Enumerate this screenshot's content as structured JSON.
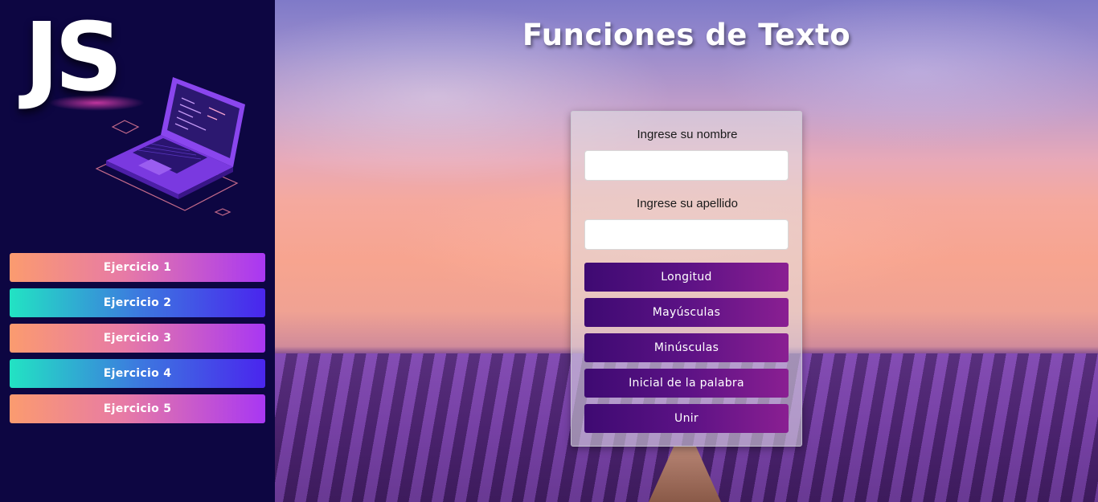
{
  "sidebar": {
    "logo_text": "JS",
    "logo_icon": "laptop-icon",
    "exercises": [
      {
        "label": "Ejercicio 1"
      },
      {
        "label": "Ejercicio 2"
      },
      {
        "label": "Ejercicio 3"
      },
      {
        "label": "Ejercicio 4"
      },
      {
        "label": "Ejercicio 5"
      }
    ],
    "colors": {
      "background": "#0d0642",
      "warm_gradient": [
        "#fb9b6f",
        "#e77aa6",
        "#a837f3"
      ],
      "cool_gradient": [
        "#22e3c3",
        "#3c7adf",
        "#4a25ee"
      ]
    }
  },
  "main": {
    "title": "Funciones de Texto",
    "form": {
      "name_label": "Ingrese su nombre",
      "name_value": "",
      "lastname_label": "Ingrese su apellido",
      "lastname_value": "",
      "buttons": [
        {
          "label": "Longitud"
        },
        {
          "label": "Mayúsculas"
        },
        {
          "label": "Minúsculas"
        },
        {
          "label": "Inicial de la palabra"
        },
        {
          "label": "Unir"
        }
      ]
    },
    "colors": {
      "button_gradient": [
        "#3e0a72",
        "#8a1f92"
      ],
      "card_background": "rgba(225,225,230,0.55)"
    },
    "background_image": "lavender-field-sunset"
  }
}
